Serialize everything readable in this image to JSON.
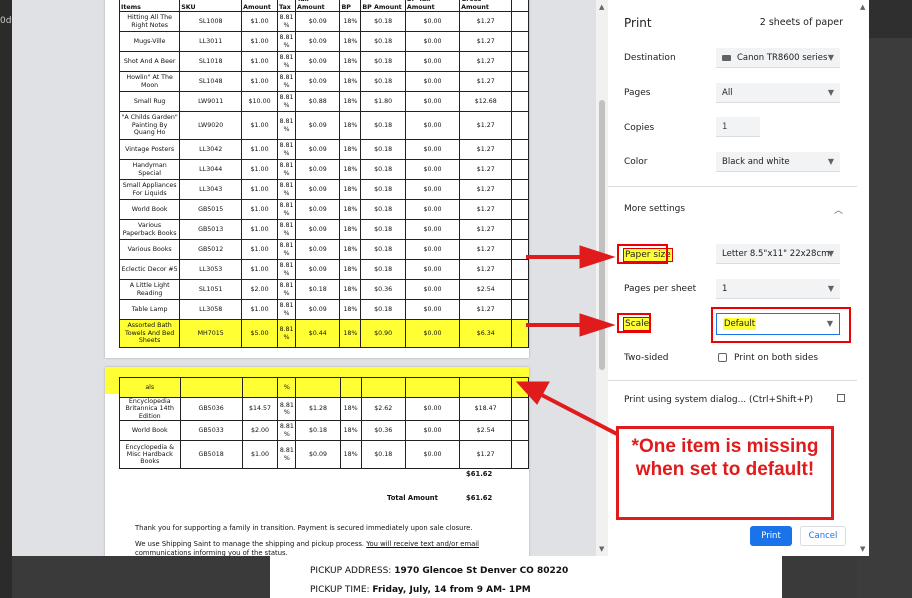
{
  "background": {
    "left_label": "0df3",
    "pickup_address_label": "PICKUP ADDRESS:",
    "pickup_address": "1970 Glencoe St Denver CO 80220",
    "pickup_time_label": "PICKUP TIME:",
    "pickup_time": "Friday, July, 14 from 9 AM- 1PM"
  },
  "table": {
    "headers": [
      "Items",
      "SKU",
      "Amount",
      "Tax",
      "Tax Amount",
      "BP",
      "BP Amount",
      "BP Tax Amount",
      "Gross Amount"
    ],
    "rows_page1": [
      {
        "item": "Hitting All The Right Notes",
        "sku": "SL1008",
        "amount": "$1.00",
        "tax": "8.81 %",
        "tax_amount": "$0.09",
        "bp": "18%",
        "bp_amount": "$0.18",
        "bp_tax": "$0.00",
        "gross": "$1.27"
      },
      {
        "item": "Mugs-Ville",
        "sku": "LL3011",
        "amount": "$1.00",
        "tax": "8.81 %",
        "tax_amount": "$0.09",
        "bp": "18%",
        "bp_amount": "$0.18",
        "bp_tax": "$0.00",
        "gross": "$1.27"
      },
      {
        "item": "Shot And A Beer",
        "sku": "SL1018",
        "amount": "$1.00",
        "tax": "8.81 %",
        "tax_amount": "$0.09",
        "bp": "18%",
        "bp_amount": "$0.18",
        "bp_tax": "$0.00",
        "gross": "$1.27"
      },
      {
        "item": "Howlin\" At The Moon",
        "sku": "SL1048",
        "amount": "$1.00",
        "tax": "8.81 %",
        "tax_amount": "$0.09",
        "bp": "18%",
        "bp_amount": "$0.18",
        "bp_tax": "$0.00",
        "gross": "$1.27"
      },
      {
        "item": "Small Rug",
        "sku": "LW9011",
        "amount": "$10.00",
        "tax": "8.81 %",
        "tax_amount": "$0.88",
        "bp": "18%",
        "bp_amount": "$1.80",
        "bp_tax": "$0.00",
        "gross": "$12.68"
      },
      {
        "item": "\"A Childs Garden\" Painting By Quang Ho",
        "sku": "LW9020",
        "amount": "$1.00",
        "tax": "8.81 %",
        "tax_amount": "$0.09",
        "bp": "18%",
        "bp_amount": "$0.18",
        "bp_tax": "$0.00",
        "gross": "$1.27",
        "tall": true
      },
      {
        "item": "Vintage Posters",
        "sku": "LL3042",
        "amount": "$1.00",
        "tax": "8.81 %",
        "tax_amount": "$0.09",
        "bp": "18%",
        "bp_amount": "$0.18",
        "bp_tax": "$0.00",
        "gross": "$1.27"
      },
      {
        "item": "Handyman Special",
        "sku": "LL3044",
        "amount": "$1.00",
        "tax": "8.81 %",
        "tax_amount": "$0.09",
        "bp": "18%",
        "bp_amount": "$0.18",
        "bp_tax": "$0.00",
        "gross": "$1.27"
      },
      {
        "item": "Small Appliances For Liquids",
        "sku": "LL3043",
        "amount": "$1.00",
        "tax": "8.81 %",
        "tax_amount": "$0.09",
        "bp": "18%",
        "bp_amount": "$0.18",
        "bp_tax": "$0.00",
        "gross": "$1.27"
      },
      {
        "item": "World Book",
        "sku": "GB5015",
        "amount": "$1.00",
        "tax": "8.81 %",
        "tax_amount": "$0.09",
        "bp": "18%",
        "bp_amount": "$0.18",
        "bp_tax": "$0.00",
        "gross": "$1.27"
      },
      {
        "item": "Various Paperback Books",
        "sku": "GB5013",
        "amount": "$1.00",
        "tax": "8.81 %",
        "tax_amount": "$0.09",
        "bp": "18%",
        "bp_amount": "$0.18",
        "bp_tax": "$0.00",
        "gross": "$1.27"
      },
      {
        "item": "Various Books",
        "sku": "GB5012",
        "amount": "$1.00",
        "tax": "8.81 %",
        "tax_amount": "$0.09",
        "bp": "18%",
        "bp_amount": "$0.18",
        "bp_tax": "$0.00",
        "gross": "$1.27"
      },
      {
        "item": "Eclectic Decor #5",
        "sku": "LL3053",
        "amount": "$1.00",
        "tax": "8.81 %",
        "tax_amount": "$0.09",
        "bp": "18%",
        "bp_amount": "$0.18",
        "bp_tax": "$0.00",
        "gross": "$1.27"
      },
      {
        "item": "A Little Light Reading",
        "sku": "SL1051",
        "amount": "$2.00",
        "tax": "8.81 %",
        "tax_amount": "$0.18",
        "bp": "18%",
        "bp_amount": "$0.36",
        "bp_tax": "$0.00",
        "gross": "$2.54"
      },
      {
        "item": "Table Lamp",
        "sku": "LL3058",
        "amount": "$1.00",
        "tax": "8.81 %",
        "tax_amount": "$0.09",
        "bp": "18%",
        "bp_amount": "$0.18",
        "bp_tax": "$0.00",
        "gross": "$1.27"
      },
      {
        "item": "Assorted Bath Towels And Bed Sheets",
        "sku": "MH7015",
        "amount": "$5.00",
        "tax": "8.81 %",
        "tax_amount": "$0.44",
        "bp": "18%",
        "bp_amount": "$0.90",
        "bp_tax": "$0.00",
        "gross": "$6.34",
        "tall": true,
        "highlight": true
      }
    ],
    "partial_row": {
      "item": "als",
      "tax": "%"
    },
    "rows_page2": [
      {
        "item": "Encyclopedia Britannica 14th Edition",
        "sku": "GB5036",
        "amount": "$14.57",
        "tax": "8.81 %",
        "tax_amount": "$1.28",
        "bp": "18%",
        "bp_amount": "$2.62",
        "bp_tax": "$0.00",
        "gross": "$18.47"
      },
      {
        "item": "World Book",
        "sku": "GB5033",
        "amount": "$2.00",
        "tax": "8.81 %",
        "tax_amount": "$0.18",
        "bp": "18%",
        "bp_amount": "$0.36",
        "bp_tax": "$0.00",
        "gross": "$2.54"
      },
      {
        "item": "Encyclopedia & Misc Hardback Books",
        "sku": "GB5018",
        "amount": "$1.00",
        "tax": "8.81 %",
        "tax_amount": "$0.09",
        "bp": "18%",
        "bp_amount": "$0.18",
        "bp_tax": "$0.00",
        "gross": "$1.27",
        "tall": true
      }
    ],
    "subtotal": "$61.62",
    "total_label": "Total Amount",
    "total": "$61.62",
    "note1": "Thank you for supporting a family in transition. Payment is secured immediately upon sale closure.",
    "note2_prefix": "We use Shipping Saint to manage the shipping and pickup process. ",
    "note2_link": "You will receive text and/or email communications informing you of the status."
  },
  "settings": {
    "title": "Print",
    "sheets": "2 sheets of paper",
    "destination_label": "Destination",
    "destination_value": "Canon TR8600 series",
    "pages_label": "Pages",
    "pages_value": "All",
    "copies_label": "Copies",
    "copies_value": "1",
    "color_label": "Color",
    "color_value": "Black and white",
    "more_settings_label": "More settings",
    "paper_size_label": "Paper size",
    "paper_size_value": "Letter 8.5\"x11\" 22x28cm",
    "pages_per_sheet_label": "Pages per sheet",
    "pages_per_sheet_value": "1",
    "scale_label": "Scale",
    "scale_value": "Default",
    "two_sided_label": "Two-sided",
    "two_sided_option": "Print on both sides",
    "system_dialog_label": "Print using system dialog... (Ctrl+Shift+P)",
    "print_button": "Print",
    "cancel_button": "Cancel"
  },
  "callout": {
    "text": "*One item is missing when set to default!"
  },
  "colors": {
    "highlight": "#ffff33",
    "annotation_red": "#e01b1b",
    "primary_blue": "#1a73e8"
  }
}
